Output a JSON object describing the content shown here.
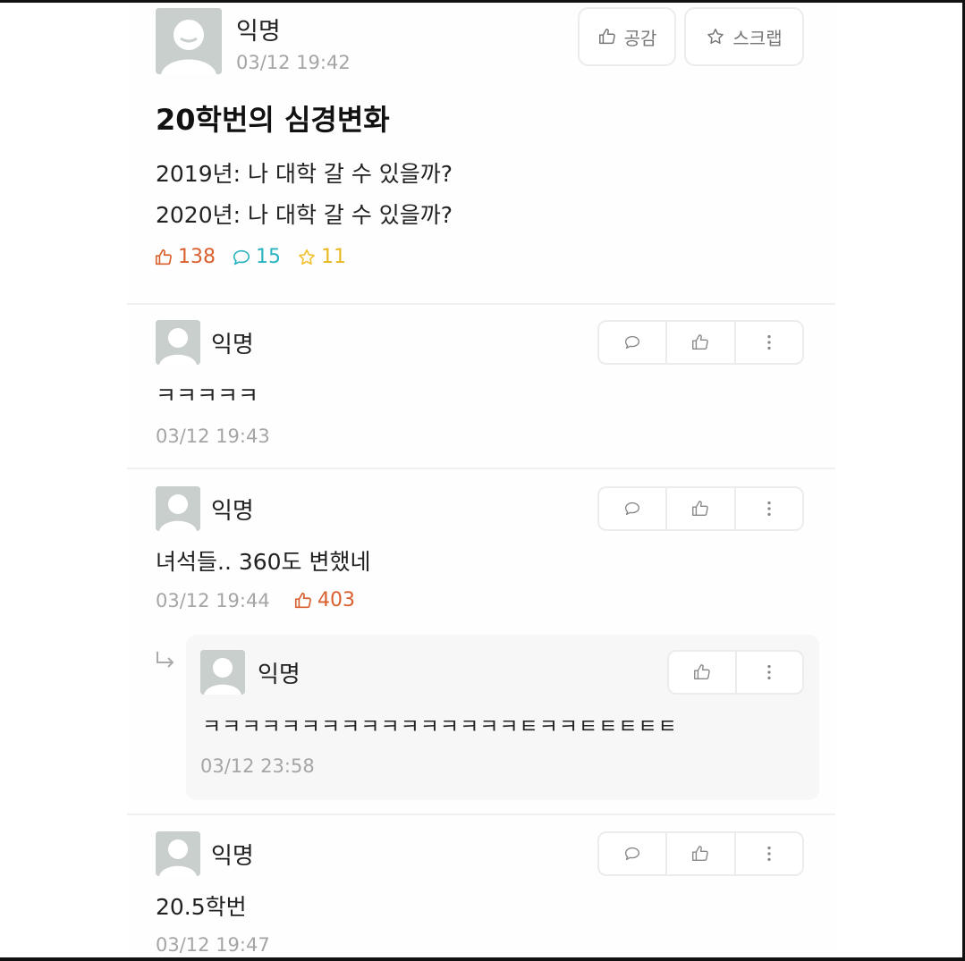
{
  "post": {
    "author": "익명",
    "time": "03/12 19:42",
    "like_button_label": "공감",
    "scrap_button_label": "스크랩",
    "title": "20학번의 심경변화",
    "body_line_1": "2019년: 나 대학 갈 수 있을까?",
    "body_line_2": "2020년: 나 대학 갈 수 있을까?",
    "likes": "138",
    "comments": "15",
    "scraps": "11"
  },
  "comments": [
    {
      "author": "익명",
      "text": "ㅋㅋㅋㅋㅋ",
      "time": "03/12 19:43"
    },
    {
      "author": "익명",
      "text": "녀석들.. 360도 변했네",
      "time": "03/12 19:44",
      "likes": "403"
    },
    {
      "author": "익명",
      "text": "20.5학번",
      "time": "03/12 19:47"
    }
  ],
  "reply": {
    "author": "익명",
    "text": "ㅋㅋㅋㅋㅋㅋㅋㅋㅋㅋㅋㅋㅋㅋㅋㅋㅌㅋㅋㅌㅌㅌㅌㅌ",
    "time": "03/12 23:58"
  },
  "colors": {
    "like": "#d9602f",
    "comment": "#2ab3c0",
    "scrap": "#f2c12e",
    "avatar": "#c9cfcc"
  }
}
